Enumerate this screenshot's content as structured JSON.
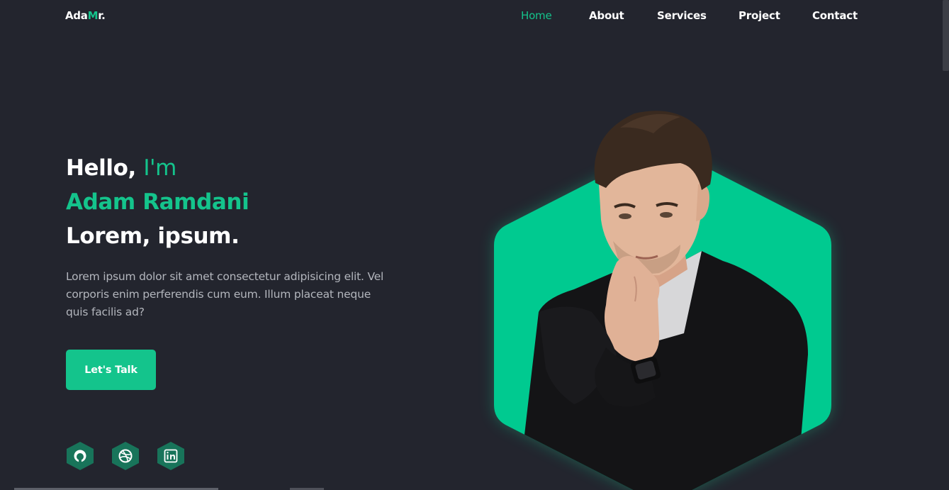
{
  "brand": {
    "prefix": "Ada",
    "accent": "M",
    "suffix": "r."
  },
  "nav": {
    "items": [
      {
        "label": "Home",
        "active": true
      },
      {
        "label": "About"
      },
      {
        "label": "Services"
      },
      {
        "label": "Project"
      },
      {
        "label": "Contact"
      }
    ]
  },
  "hero": {
    "greeting_prefix": "Hello,",
    "greeting_accent": "I'm",
    "name": "Adam Ramdani",
    "tagline": "Lorem, ipsum.",
    "description": "Lorem ipsum dolor sit amet consectetur adipisicing elit. Vel corporis enim perferendis cum eum. Illum placeat neque quis facilis ad?",
    "cta_label": "Let's Talk"
  },
  "socials": [
    {
      "icon": "github-icon"
    },
    {
      "icon": "dribbble-icon"
    },
    {
      "icon": "linkedin-icon"
    }
  ],
  "colors": {
    "background": "#23252e",
    "accent": "#14c48c",
    "text": "#ffffff",
    "muted": "#b3b6bd"
  }
}
